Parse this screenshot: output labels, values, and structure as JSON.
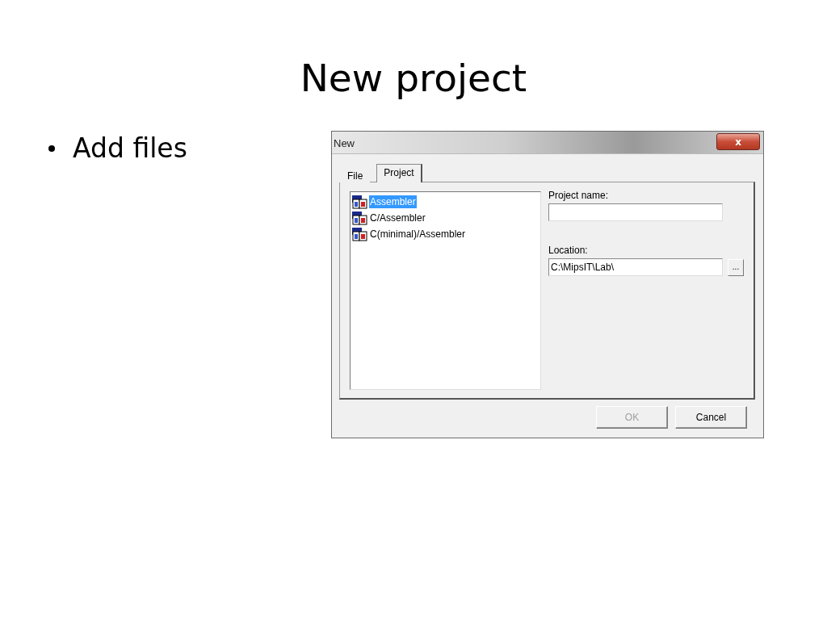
{
  "slide": {
    "title": "New project",
    "bullets": [
      "Add files"
    ]
  },
  "dialog": {
    "title": "New",
    "close": "x",
    "tabs": [
      {
        "label": "File",
        "selected": false
      },
      {
        "label": "Project",
        "selected": true
      }
    ],
    "templates": [
      {
        "label": "Assembler",
        "selected": true
      },
      {
        "label": "C/Assembler",
        "selected": false
      },
      {
        "label": "C(minimal)/Assembler",
        "selected": false
      }
    ],
    "project_name": {
      "label": "Project name:"
    },
    "location": {
      "label": "Location:",
      "value": "C:\\MipsIT\\Lab\\",
      "browse": "..."
    },
    "buttons": [
      {
        "label": "OK",
        "disabled": true
      },
      {
        "label": "Cancel",
        "disabled": false
      }
    ]
  }
}
